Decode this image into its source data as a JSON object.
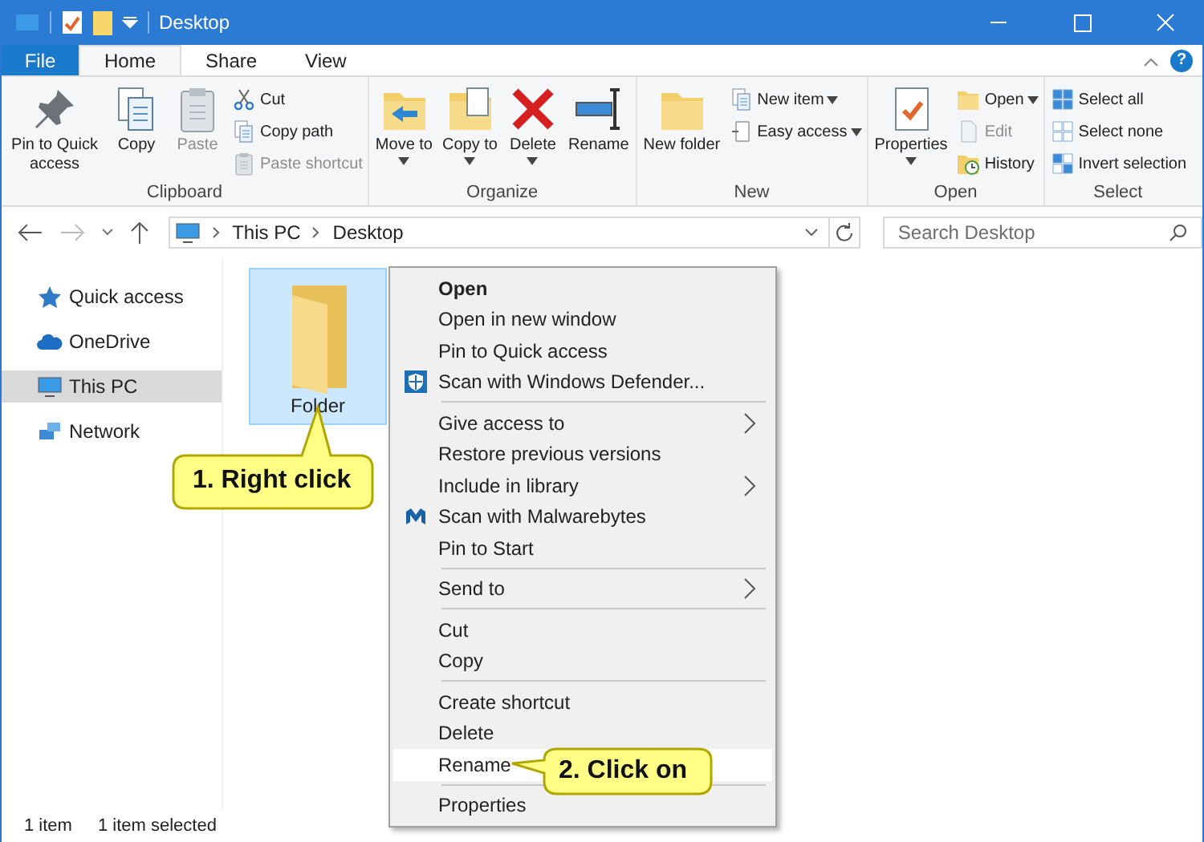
{
  "window": {
    "title": "Desktop"
  },
  "ribbon_tabs": [
    {
      "label": "File",
      "kind": "file",
      "selected": false
    },
    {
      "label": "Home",
      "kind": "tab",
      "selected": true
    },
    {
      "label": "Share",
      "kind": "tab",
      "selected": false
    },
    {
      "label": "View",
      "kind": "tab",
      "selected": false
    }
  ],
  "help_button": "?",
  "ribbon_groups": [
    {
      "label": "Clipboard",
      "large": [
        {
          "label": "Pin to Quick access",
          "disabled": false,
          "dropdown": false
        },
        {
          "label": "Copy",
          "disabled": false,
          "dropdown": false
        },
        {
          "label": "Paste",
          "disabled": true,
          "dropdown": false
        }
      ],
      "small": [
        {
          "label": "Cut",
          "disabled": false,
          "dropdown": false
        },
        {
          "label": "Copy path",
          "disabled": false,
          "dropdown": false
        },
        {
          "label": "Paste shortcut",
          "disabled": true,
          "dropdown": false
        }
      ]
    },
    {
      "label": "Organize",
      "large": [
        {
          "label": "Move to",
          "disabled": false,
          "dropdown": true
        },
        {
          "label": "Copy to",
          "disabled": false,
          "dropdown": true
        },
        {
          "label": "Delete",
          "disabled": false,
          "dropdown": true
        },
        {
          "label": "Rename",
          "disabled": false,
          "dropdown": false
        }
      ]
    },
    {
      "label": "New",
      "large": [
        {
          "label": "New folder",
          "disabled": false,
          "dropdown": false
        }
      ],
      "small": [
        {
          "label": "New item",
          "disabled": false,
          "dropdown": true
        },
        {
          "label": "Easy access",
          "disabled": false,
          "dropdown": true
        }
      ]
    },
    {
      "label": "Open",
      "large": [
        {
          "label": "Properties",
          "disabled": false,
          "dropdown": true
        }
      ],
      "small": [
        {
          "label": "Open",
          "disabled": false,
          "dropdown": true
        },
        {
          "label": "Edit",
          "disabled": true,
          "dropdown": false
        },
        {
          "label": "History",
          "disabled": false,
          "dropdown": false
        }
      ]
    },
    {
      "label": "Select",
      "small": [
        {
          "label": "Select all",
          "disabled": false,
          "dropdown": false
        },
        {
          "label": "Select none",
          "disabled": false,
          "dropdown": false
        },
        {
          "label": "Invert selection",
          "disabled": false,
          "dropdown": false
        }
      ]
    }
  ],
  "address": {
    "path": [
      "This PC",
      "Desktop"
    ],
    "search": {
      "placeholder": "Search Desktop"
    }
  },
  "nav": [
    {
      "label": "Quick access",
      "selected": false
    },
    {
      "label": "OneDrive",
      "selected": false
    },
    {
      "label": "This PC",
      "selected": true
    },
    {
      "label": "Network",
      "selected": false
    }
  ],
  "files": [
    {
      "label": "Folder",
      "selected": true
    }
  ],
  "context_menu": {
    "sections": [
      [
        {
          "label": "Open",
          "bold": true,
          "submenu": false,
          "selected": false
        },
        {
          "label": "Open in new window",
          "bold": false,
          "submenu": false,
          "selected": false
        },
        {
          "label": "Pin to Quick access",
          "bold": false,
          "submenu": false,
          "selected": false
        },
        {
          "label": "Scan with Windows Defender...",
          "bold": false,
          "submenu": false,
          "selected": false
        }
      ],
      [
        {
          "label": "Give access to",
          "bold": false,
          "submenu": true,
          "selected": false
        },
        {
          "label": "Restore previous versions",
          "bold": false,
          "submenu": false,
          "selected": false
        },
        {
          "label": "Include in library",
          "bold": false,
          "submenu": true,
          "selected": false
        },
        {
          "label": "Scan with Malwarebytes",
          "bold": false,
          "submenu": false,
          "selected": false
        },
        {
          "label": "Pin to Start",
          "bold": false,
          "submenu": false,
          "selected": false
        }
      ],
      [
        {
          "label": "Send to",
          "bold": false,
          "submenu": true,
          "selected": false
        }
      ],
      [
        {
          "label": "Cut",
          "bold": false,
          "submenu": false,
          "selected": false
        },
        {
          "label": "Copy",
          "bold": false,
          "submenu": false,
          "selected": false
        }
      ],
      [
        {
          "label": "Create shortcut",
          "bold": false,
          "submenu": false,
          "selected": false
        },
        {
          "label": "Delete",
          "bold": false,
          "submenu": false,
          "selected": false
        },
        {
          "label": "Rename",
          "bold": false,
          "submenu": false,
          "selected": true
        }
      ],
      [
        {
          "label": "Properties",
          "bold": false,
          "submenu": false,
          "selected": false
        }
      ]
    ]
  },
  "callouts": [
    {
      "text": "1. Right click"
    },
    {
      "text": "2. Click on"
    }
  ],
  "status_bar": [
    "1 item",
    "1 item selected"
  ]
}
